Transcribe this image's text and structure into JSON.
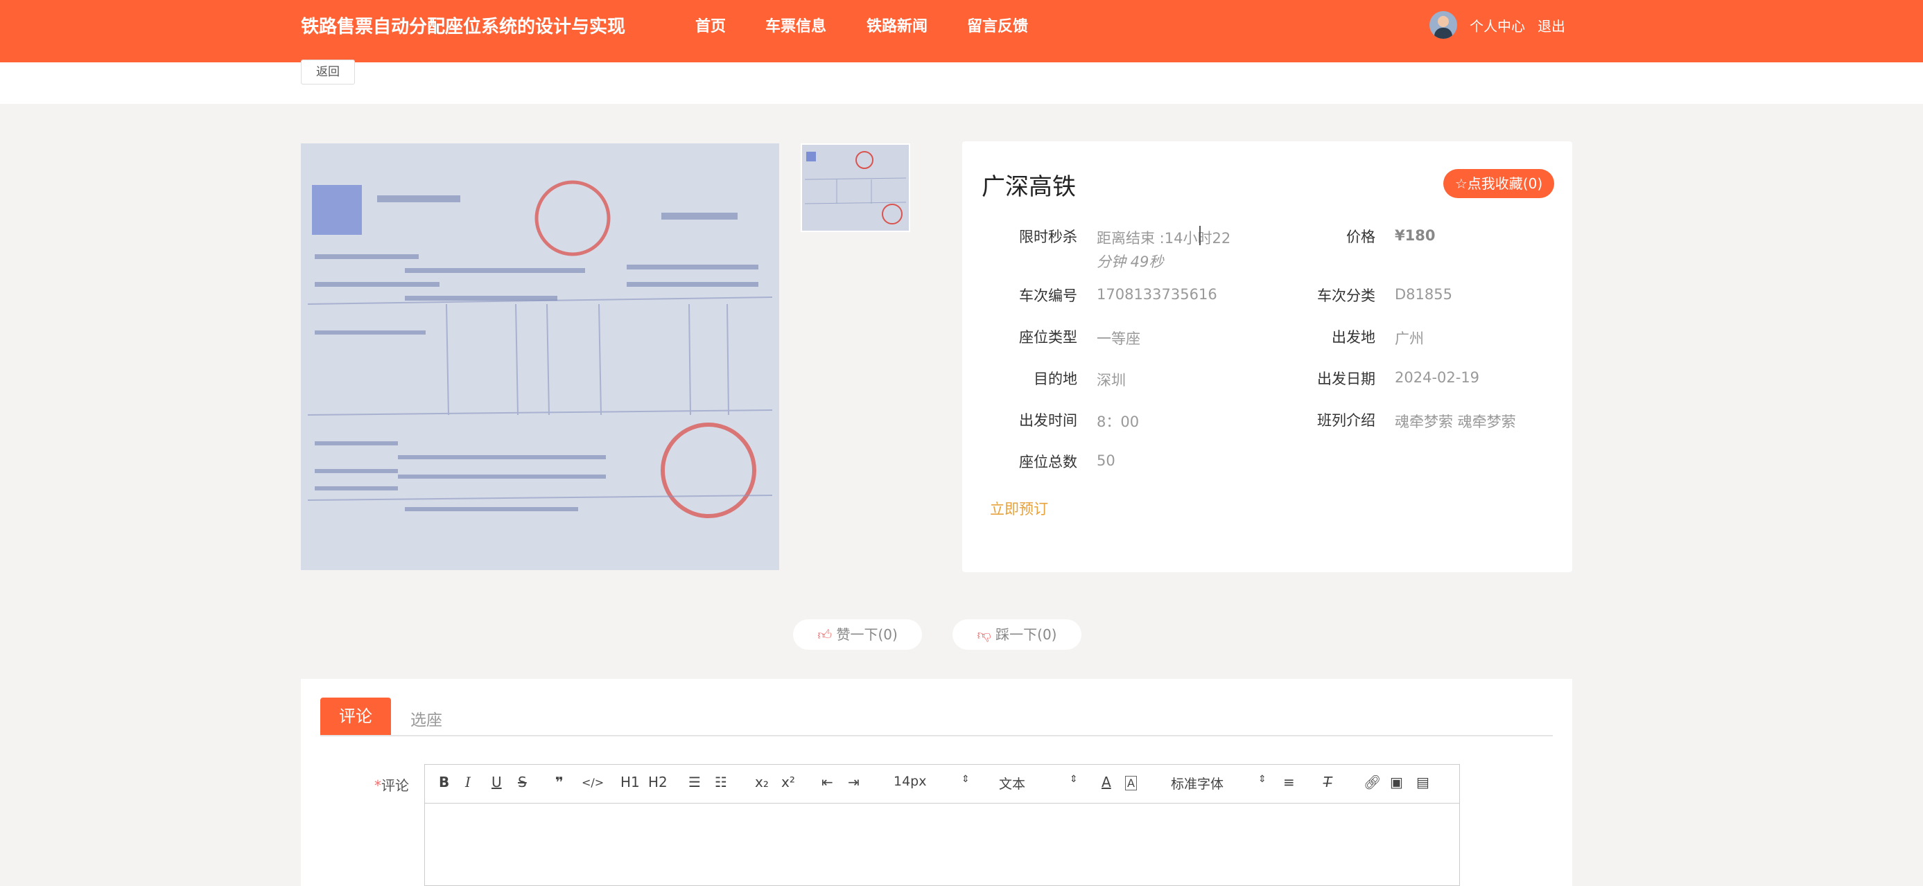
{
  "header": {
    "brand": "铁路售票自动分配座位系统的设计与实现",
    "nav": [
      "首页",
      "车票信息",
      "铁路新闻",
      "留言反馈"
    ],
    "profile": "个人中心",
    "logout": "退出"
  },
  "back_label": "返回",
  "product": {
    "title": "广深高铁",
    "favorite_label": "点我收藏(0)",
    "fields": {
      "flash_label": "限时秒杀",
      "flash_countdown_line1": "距离结束 :14小时22",
      "flash_countdown_line2": "分钟 49秒",
      "price_label": "价格",
      "price_value": "¥180",
      "train_no_label": "车次编号",
      "train_no_value": "1708133735616",
      "category_label": "车次分类",
      "category_value": "D81855",
      "seat_type_label": "座位类型",
      "seat_type_value": "一等座",
      "origin_label": "出发地",
      "origin_value": "广州",
      "dest_label": "目的地",
      "dest_value": "深圳",
      "date_label": "出发日期",
      "date_value": "2024-02-19",
      "time_label": "出发时间",
      "time_value": "8：00",
      "intro_label": "班列介绍",
      "intro_value": "魂牵梦萦 魂牵梦萦",
      "seats_label": "座位总数",
      "seats_value": "50"
    },
    "order_label": "立即预订"
  },
  "votes": {
    "like": "赞一下(0)",
    "dislike": "踩一下(0)"
  },
  "tabs": [
    "评论",
    "选座"
  ],
  "comment": {
    "label": "评论",
    "required_mark": "*",
    "toolbar": {
      "font_size": "14px",
      "format": "文本",
      "font_family": "标准字体",
      "h1": "H1",
      "h2": "H2"
    }
  },
  "colors": {
    "accent": "#ff6234",
    "order_link": "#e6a23c"
  }
}
